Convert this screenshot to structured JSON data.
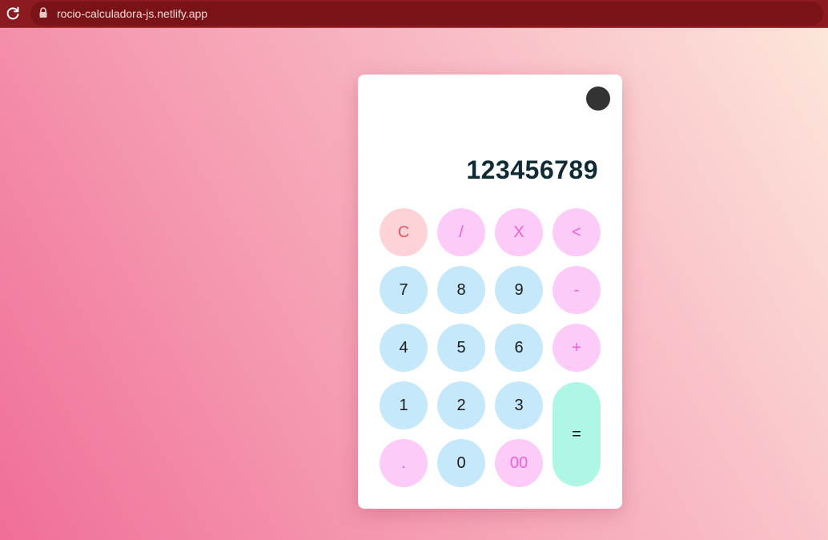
{
  "browser": {
    "url": "rocio-calculadora-js.netlify.app"
  },
  "calculator": {
    "display": "123456789",
    "buttons": {
      "clear": "C",
      "divide": "/",
      "multiply": "X",
      "backspace": "<",
      "seven": "7",
      "eight": "8",
      "nine": "9",
      "minus": "-",
      "four": "4",
      "five": "5",
      "six": "6",
      "plus": "+",
      "one": "1",
      "two": "2",
      "three": "3",
      "equals": "=",
      "dot": ".",
      "zero": "0",
      "double_zero": "00"
    }
  },
  "colors": {
    "browser_bar": "#8b1a1e",
    "number_button": "#c5e8fa",
    "operator_button": "#fccbf8",
    "clear_button": "#fdd3d8",
    "equals_button": "#aef6e6",
    "theme_toggle": "#333333"
  }
}
